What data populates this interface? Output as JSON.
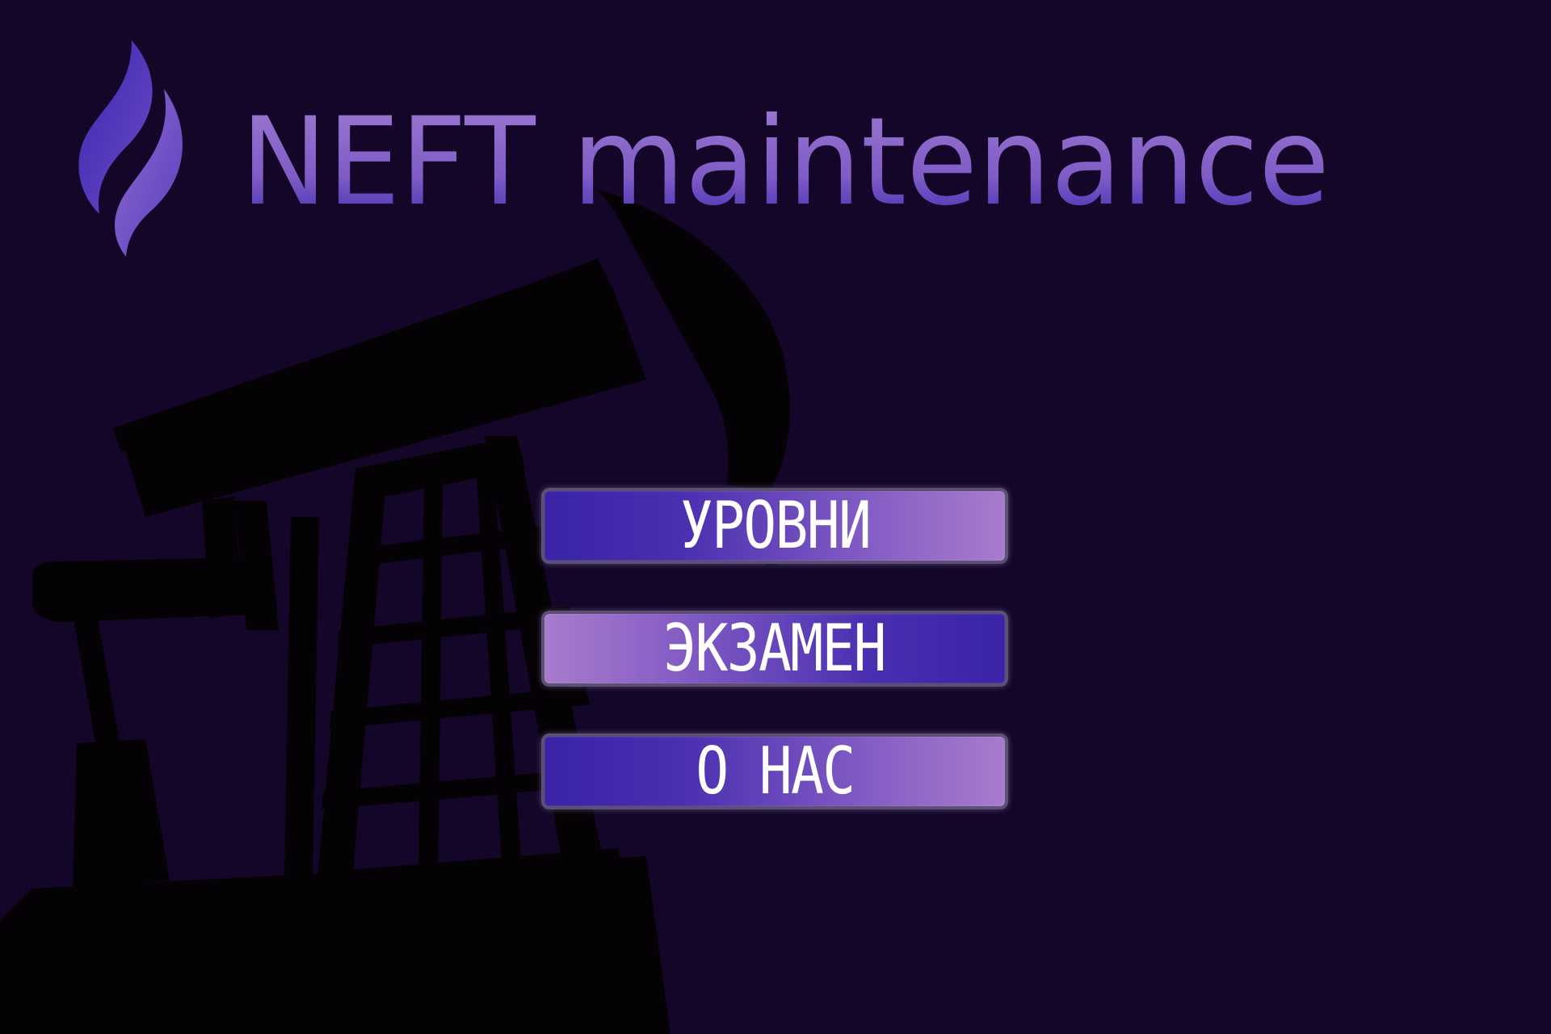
{
  "app": {
    "title": "NEFT maintenance"
  },
  "menu": {
    "levels_label": "УРОВНИ",
    "exam_label": "ЭКЗАМЕН",
    "about_label": "О НАС"
  },
  "colors": {
    "background": "#130628",
    "silhouette": "#050205",
    "accent_dark": "#3a23a6",
    "accent_light": "#a77ccc",
    "button_text": "#ffffff"
  },
  "icons": {
    "logo": "flame-icon",
    "background_image": "oil-pump-jack-silhouette"
  }
}
